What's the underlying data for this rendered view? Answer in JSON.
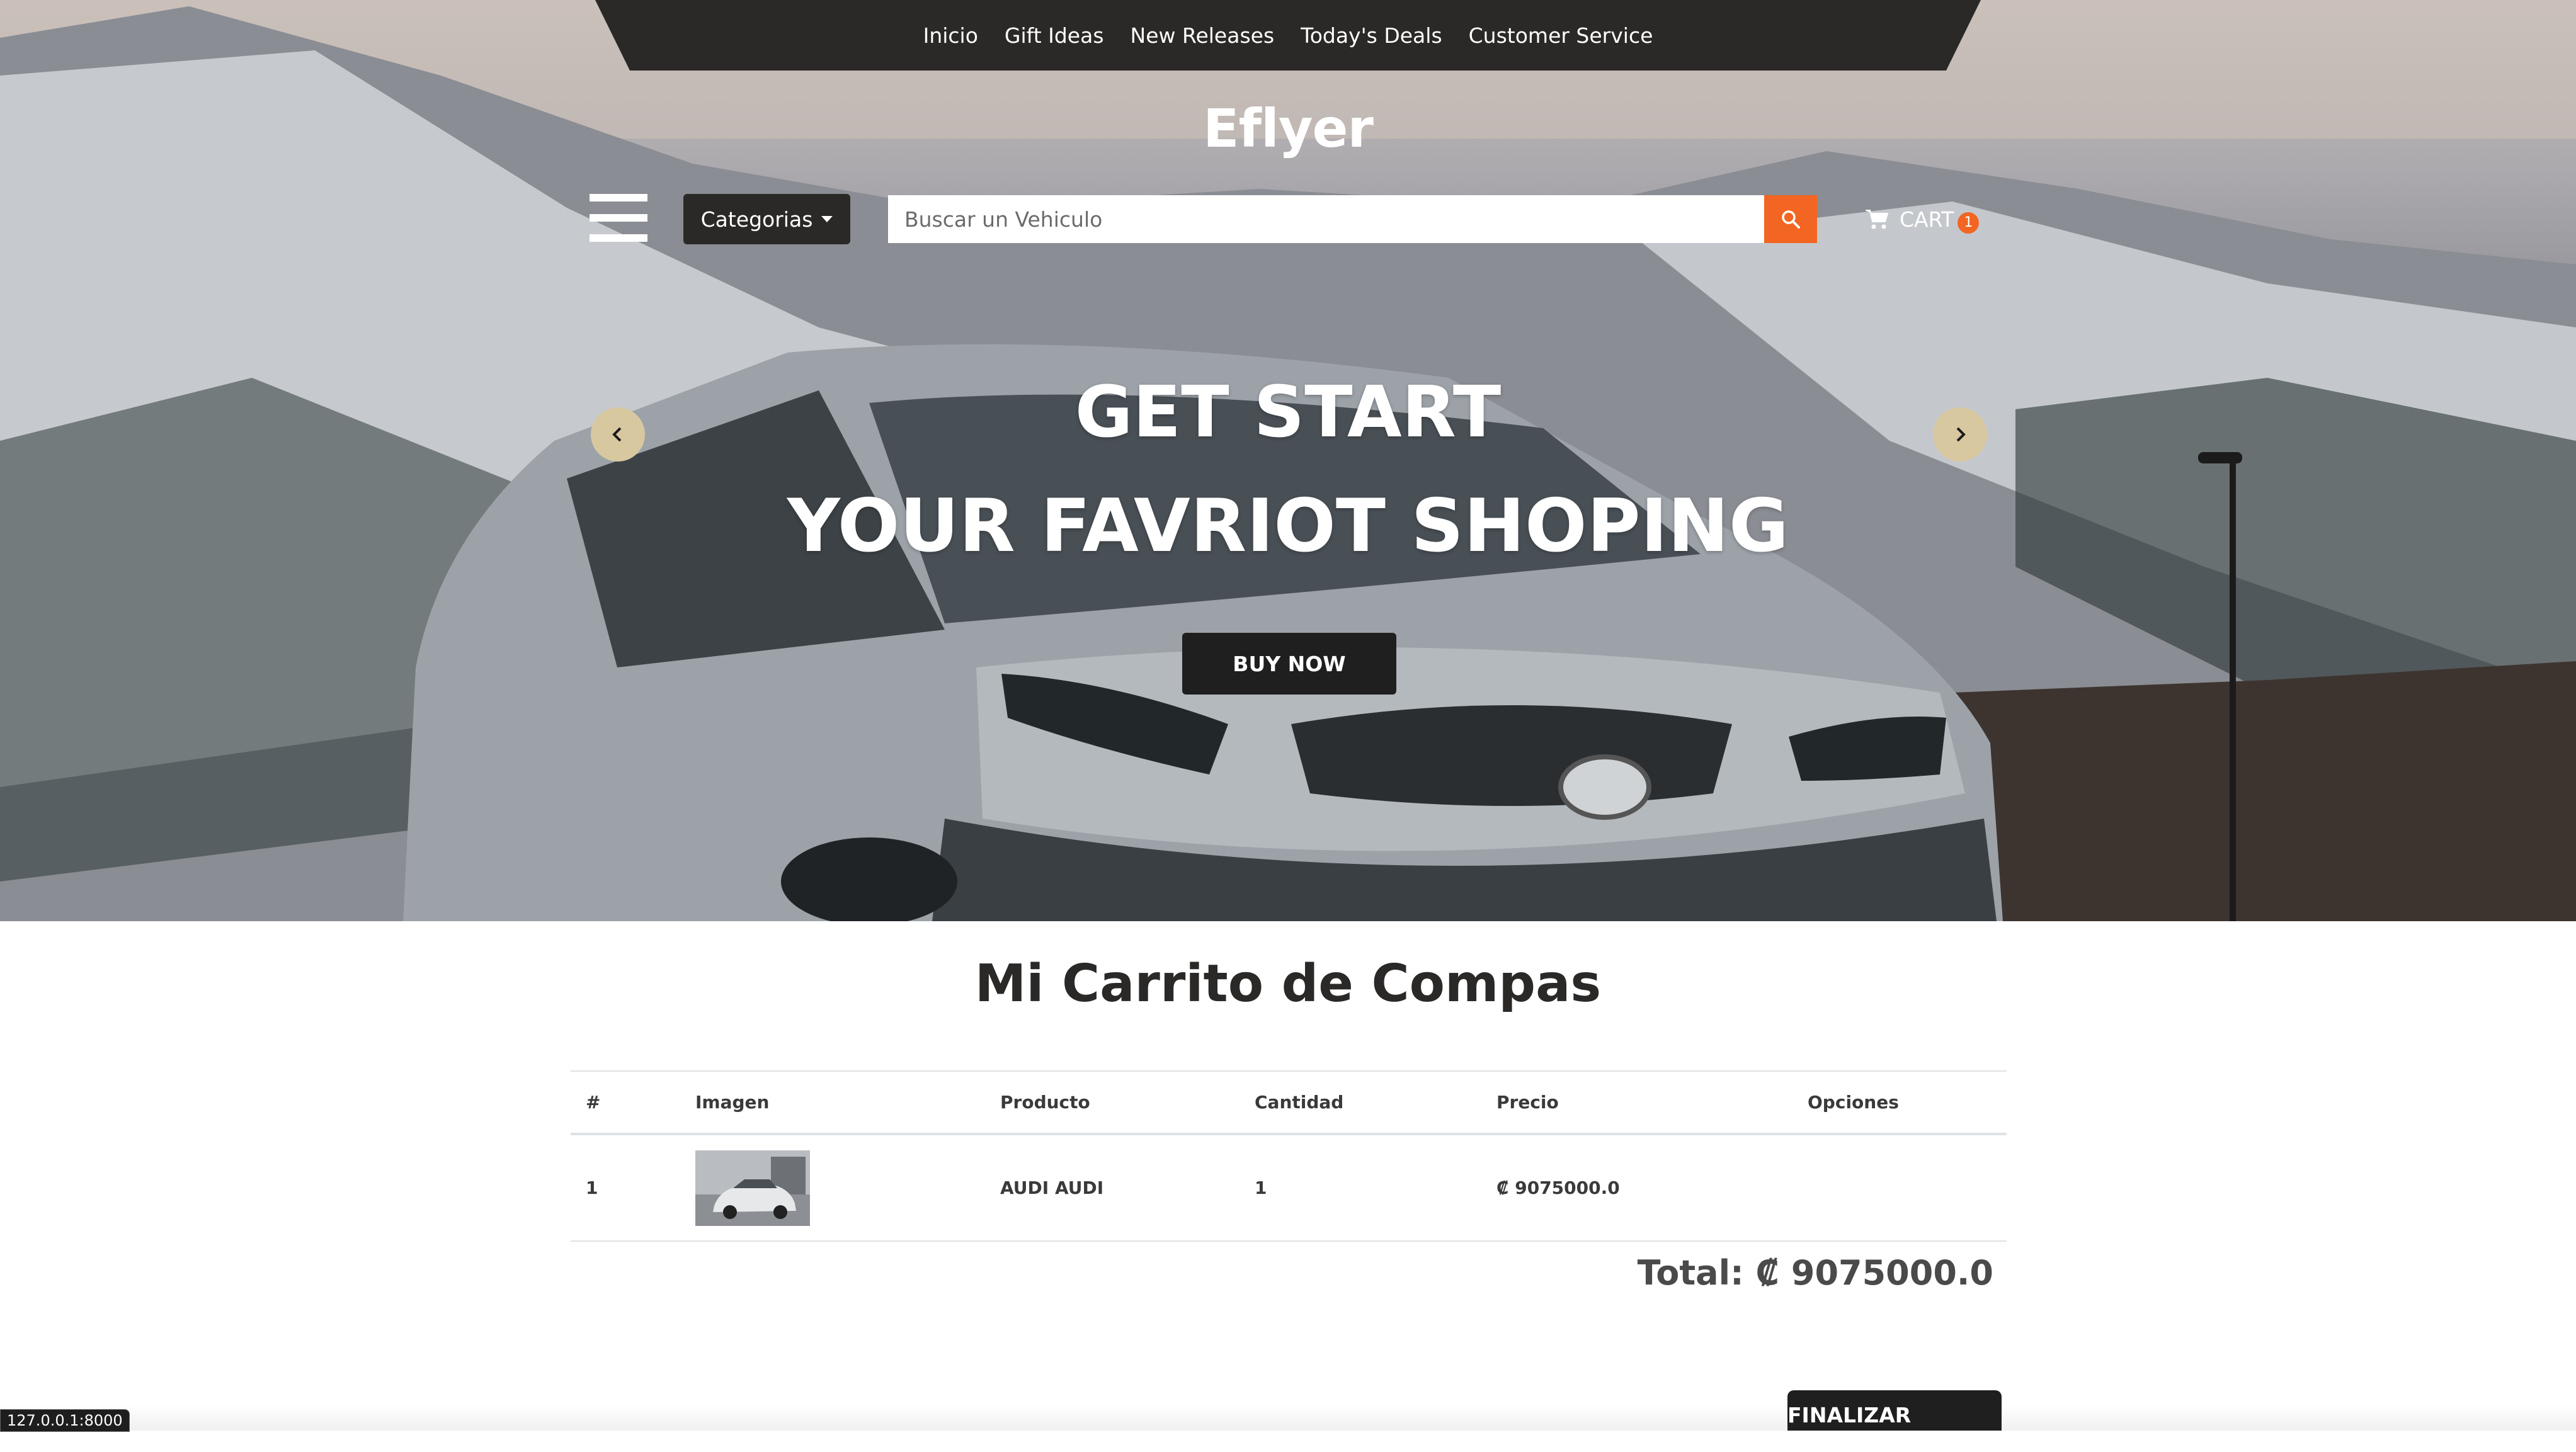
{
  "topnav": {
    "items": [
      "Inicio",
      "Gift Ideas",
      "New Releases",
      "Today's Deals",
      "Customer Service"
    ]
  },
  "brand": {
    "logo": "Eflyer"
  },
  "toolbar": {
    "categories_label": "Categorias",
    "search_placeholder": "Buscar un Vehiculo",
    "cart_label": "CART",
    "cart_count": "1"
  },
  "hero": {
    "line1": "GET START",
    "line2": "YOUR FAVRIOT SHOPING",
    "buy_label": "BUY NOW"
  },
  "cart": {
    "title": "Mi Carrito de Compas",
    "columns": [
      "#",
      "Imagen",
      "Producto",
      "Cantidad",
      "Precio",
      "Opciones"
    ],
    "rows": [
      {
        "index": "1",
        "product": "AUDI AUDI",
        "quantity": "1",
        "price": "₡ 9075000.0",
        "options": ""
      }
    ],
    "total": "Total: ₡ 9075000.0",
    "finalize_label": "FINALIZAR COMPRA"
  },
  "status_bar": {
    "url": "127.0.0.1:8000"
  },
  "colors": {
    "accent": "#f26522",
    "dark": "#2b2927",
    "button": "#1f1f1f"
  },
  "icons": {
    "menu": "hamburger-icon",
    "search": "search-icon",
    "cart": "cart-icon",
    "prev": "chevron-left-icon",
    "next": "chevron-right-icon"
  }
}
